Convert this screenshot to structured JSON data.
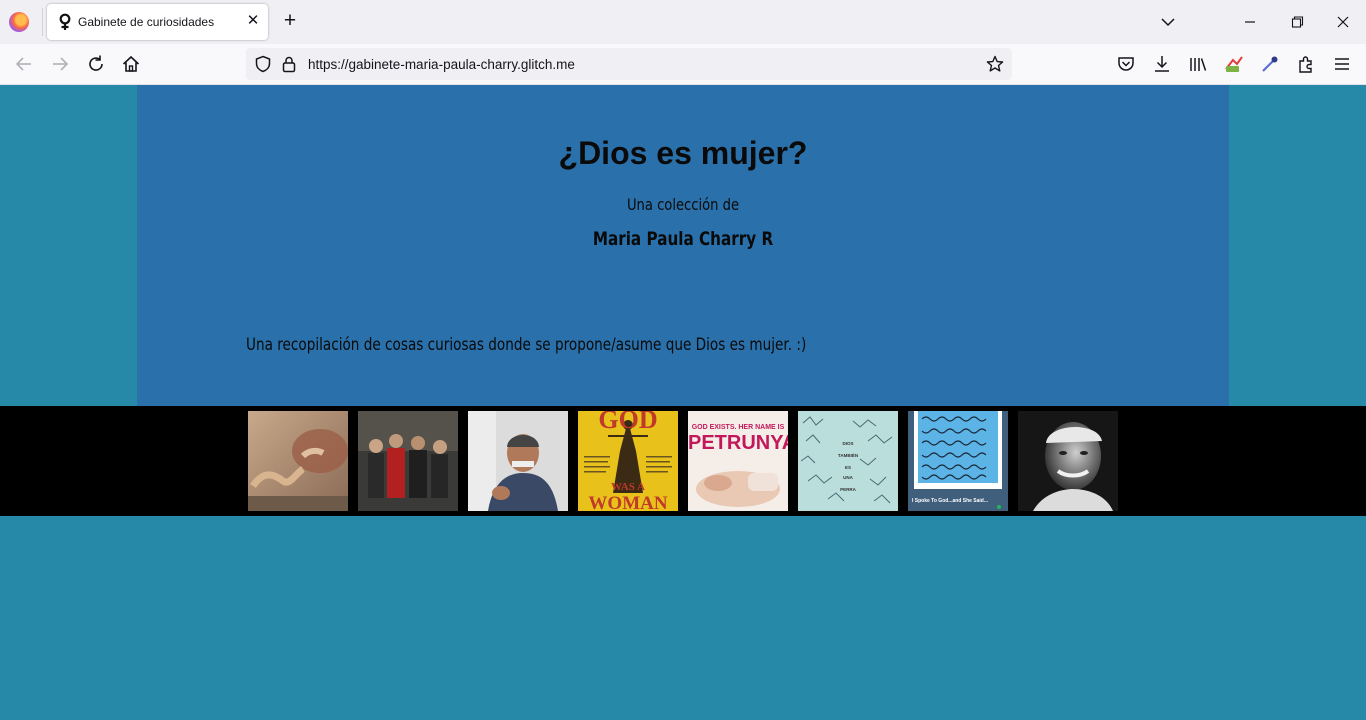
{
  "browser": {
    "tab_title": "Gabinete de curiosidades",
    "url": "https://gabinete-maria-paula-charry.glitch.me"
  },
  "page": {
    "title": "¿Dios es mujer?",
    "subtitle": "Una colección de",
    "author": "Maria Paula Charry R",
    "description": "Una recopilación de cosas curiosas donde se propone/asume que Dios es mujer. :)"
  },
  "gallery": {
    "god_was_a_woman": {
      "top": "GOD",
      "bottom1": "WAS A",
      "bottom2": "WOMAN"
    },
    "petrunya": {
      "line1": "GOD EXISTS. HER NAME IS",
      "line2": "PETRUNYA"
    },
    "perra_book": {
      "words": [
        "DIOS",
        "TAMBIÉN",
        "ES",
        "UNA",
        "PERRA"
      ]
    },
    "spotify": {
      "caption": "I Spoke To God...and She Said..."
    }
  },
  "colors": {
    "page_bg": "#2789a8",
    "hero_bg": "#2a70aa",
    "gallery_bg": "#000000"
  }
}
